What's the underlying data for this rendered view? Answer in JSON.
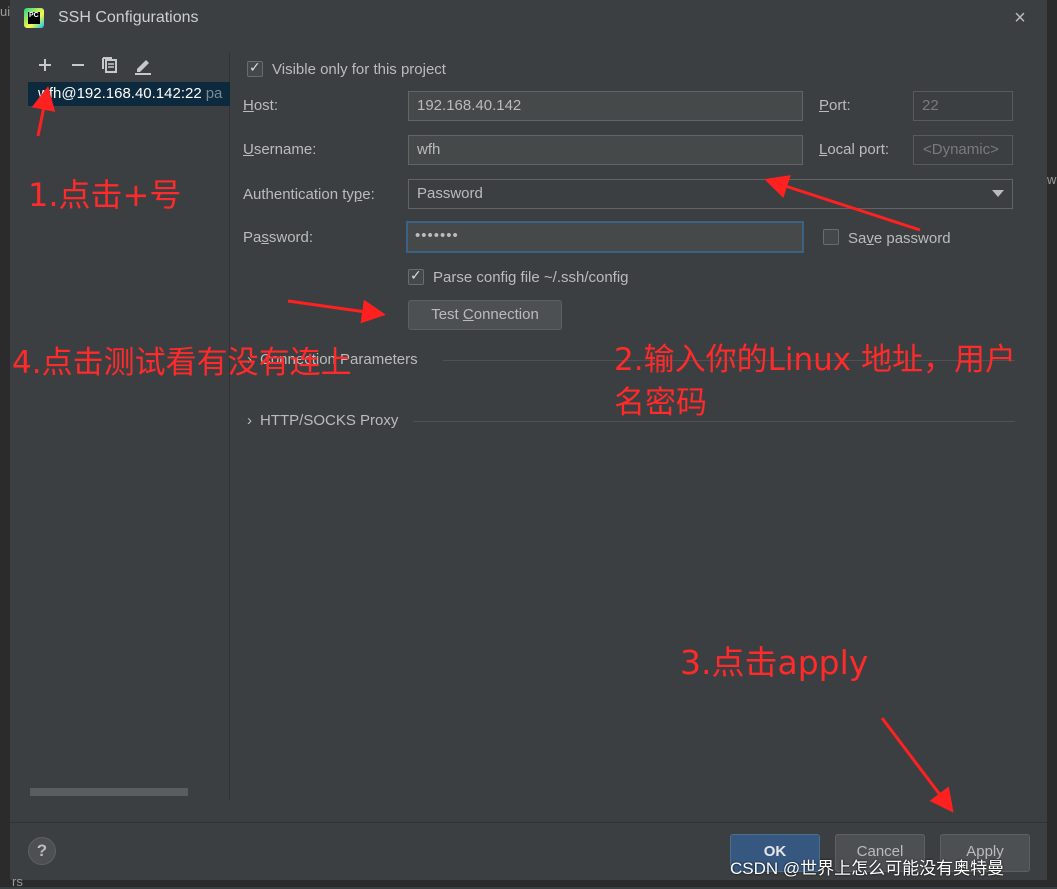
{
  "window": {
    "title": "SSH Configurations",
    "close_glyph": "×"
  },
  "outer": {
    "left_top_text": "ui",
    "right_text": "w",
    "bottom_left_text": "rs"
  },
  "left_panel": {
    "toolbar": [
      {
        "name": "add-icon",
        "glyph": "+"
      },
      {
        "name": "remove-icon",
        "glyph": "−"
      },
      {
        "name": "copy-icon",
        "glyph": "copy"
      },
      {
        "name": "edit-icon",
        "glyph": "pencil"
      }
    ],
    "configs": [
      {
        "label": "wfh@192.168.40.142:22",
        "tag": "pa"
      }
    ]
  },
  "form": {
    "visible_only_label": "Visible only for this project",
    "visible_only_checked": true,
    "host": {
      "label_u": "H",
      "label_rest": "ost:",
      "value": "192.168.40.142"
    },
    "port": {
      "label_u": "P",
      "label_rest": "ort:",
      "value": "22"
    },
    "username": {
      "label_u": "U",
      "label_rest": "sername:",
      "value": "wfh"
    },
    "local_port": {
      "label_u": "L",
      "label_rest": "ocal port:",
      "placeholder": "<Dynamic>"
    },
    "auth_type": {
      "label_pre": "Authentication ty",
      "label_u": "p",
      "label_rest": "e:",
      "value": "Password"
    },
    "password": {
      "label_pre": "Pa",
      "label_u": "s",
      "label_rest": "sword:",
      "masked": "•••••••"
    },
    "save_password": {
      "label_pre": "Sa",
      "label_u": "v",
      "label_rest": "e password",
      "checked": false
    },
    "parse_config": {
      "label": "Parse config file ~/.ssh/config",
      "checked": true
    },
    "test_connection": {
      "label_pre": "Test ",
      "label_u": "C",
      "label_rest": "onnection"
    },
    "sections": [
      {
        "label": "Connection Parameters"
      },
      {
        "label": "HTTP/SOCKS Proxy"
      }
    ]
  },
  "footer": {
    "help": "?",
    "ok": "OK",
    "cancel": "Cancel",
    "apply": "Apply"
  },
  "annotations": {
    "step1": "1.点击+号",
    "step2_line1": "2.输入你的Linux 地址，用户",
    "step2_line2": "名密码",
    "step3": "3.点击apply",
    "step4": "4.点击测试看有没有连上",
    "watermark": "CSDN @世界上怎么可能没有奥特曼",
    "arrow_color": "#ff2020"
  }
}
